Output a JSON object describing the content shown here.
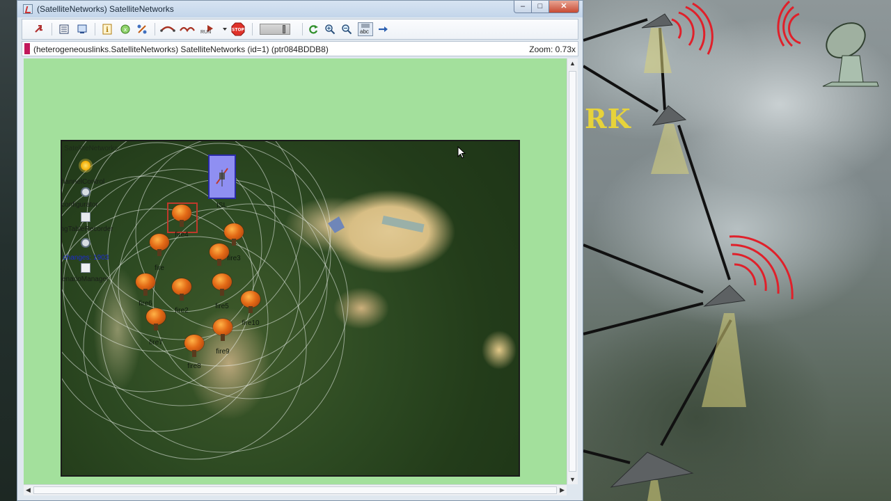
{
  "window": {
    "title": "(SatelliteNetworks) SatelliteNetworks",
    "controls": {
      "minimize": "–",
      "maximize": "□",
      "close": "✕"
    }
  },
  "toolbar": {
    "run_label": "RUN",
    "stop_label": "STOP",
    "abc_label": "abc",
    "icons": [
      "back-icon",
      "module-output-icon",
      "inspect-icon",
      "info-icon",
      "object-tree-icon",
      "network-icon",
      "step-icon",
      "fast-run-icon",
      "run-icon",
      "run-dropdown-icon",
      "stop-icon",
      "speed-slider",
      "refresh-icon",
      "zoom-in-icon",
      "zoom-out-icon",
      "show-labels-icon",
      "arrow-icon"
    ]
  },
  "infobar": {
    "path": "(heterogeneouslinks.SatelliteNetworks) SatelliteNetworks  (id=1)  (ptr084BDDB8)",
    "zoom": "Zoom: 0.73x"
  },
  "network": {
    "label": "SatelliteNetworks",
    "side_modules": [
      {
        "name": "channelControl",
        "icon": "sun-icon"
      },
      {
        "name": "configurator",
        "icon": "cog-icon"
      },
      {
        "name": "routingTableRecorder",
        "icon": "table-icon"
      },
      {
        "name": "lifecycleController",
        "icon": "cog-icon"
      },
      {
        "name": "scenarioManager",
        "icon": "document-icon"
      }
    ],
    "overlay_text": "total changes: 1903",
    "isl_label": "ISL",
    "fire_nodes": [
      "fire4",
      "fire",
      "fire3",
      "fire6",
      "fire2",
      "fire5",
      "fire10",
      "fire7",
      "fire9",
      "fire8"
    ]
  },
  "background": {
    "brand_text": "RK",
    "accent_color": "#e7d33a",
    "signal_color": "#e0202a"
  },
  "colors": {
    "canvas_bg": "#a3e09c",
    "isl_fill": "#8f8ff2",
    "selection": "#c0392b"
  }
}
